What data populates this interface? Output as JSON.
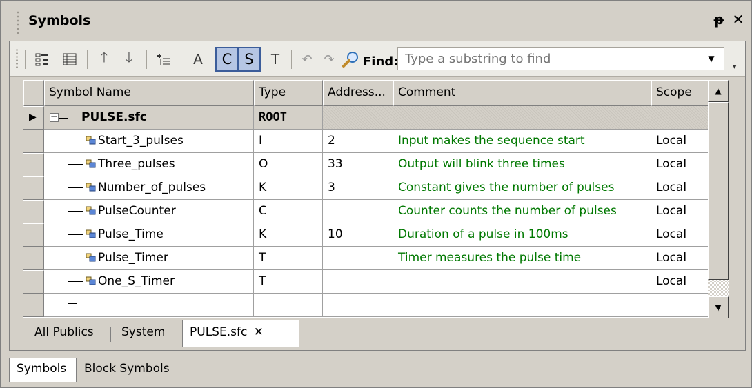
{
  "window": {
    "title": "Symbols",
    "pin_glyph": "ᵽ",
    "close_glyph": "✕"
  },
  "toolbar": {
    "btn_a": "A",
    "btn_c": "C",
    "btn_s": "S",
    "btn_t": "T",
    "find_label": "Find:",
    "find_placeholder": "Type a substring to find",
    "icons": [
      "tree-view-icon",
      "list-view-icon",
      "move-up-icon",
      "move-down-icon",
      "insert-row-icon",
      "undo-icon",
      "redo-icon",
      "search-icon"
    ]
  },
  "grid": {
    "columns": [
      "Symbol Name",
      "Type",
      "Address...",
      "Comment",
      "Scope"
    ],
    "root": {
      "name": "PULSE.sfc",
      "type": "ROOT"
    },
    "rows": [
      {
        "name": "Start_3_pulses",
        "type": "I",
        "address": "2",
        "comment": "Input makes the sequence start",
        "scope": "Local"
      },
      {
        "name": "Three_pulses",
        "type": "O",
        "address": "33",
        "comment": "Output will blink three times",
        "scope": "Local"
      },
      {
        "name": "Number_of_pulses",
        "type": "K",
        "address": "3",
        "comment": "Constant gives the number of pulses",
        "scope": "Local"
      },
      {
        "name": "PulseCounter",
        "type": "C",
        "address": "",
        "comment": "Counter counts the number of pulses",
        "scope": "Local"
      },
      {
        "name": "Pulse_Time",
        "type": "K",
        "address": "10",
        "comment": "Duration of a pulse in 100ms",
        "scope": "Local"
      },
      {
        "name": "Pulse_Timer",
        "type": "T",
        "address": "",
        "comment": "Timer measures the pulse time",
        "scope": "Local"
      },
      {
        "name": "One_S_Timer",
        "type": "T",
        "address": "",
        "comment": "",
        "scope": "Local"
      }
    ]
  },
  "doc_tabs": {
    "all_publics": "All Publics",
    "system": "System",
    "pulse": "PULSE.sfc",
    "close_glyph": "✕"
  },
  "window_tabs": {
    "symbols": "Symbols",
    "block_symbols": "Block Symbols"
  },
  "colors": {
    "comment": "#007800",
    "toggle_bg": "#b6c6e4",
    "toggle_border": "#3c5d9a"
  }
}
